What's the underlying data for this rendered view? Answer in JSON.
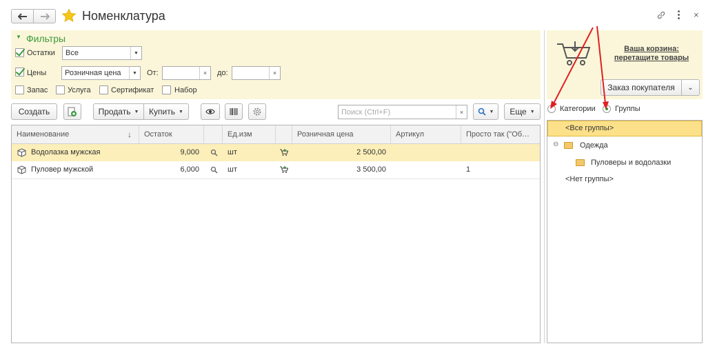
{
  "window": {
    "title": "Номенклатура",
    "back_icon": "arrow-left-icon",
    "forward_icon": "arrow-right-icon",
    "favorite_icon": "star-icon",
    "link_icon": "link-icon",
    "more_icon": "more-vertical-icon",
    "close_icon": "close-icon"
  },
  "filters": {
    "header": "Фильтры",
    "stock": {
      "label": "Остатки",
      "checked": true,
      "value": "Все"
    },
    "prices": {
      "label": "Цены",
      "checked": true,
      "value": "Розничная цена",
      "from_label": "От:",
      "to_label": "до:",
      "from_value": "",
      "to_value": ""
    },
    "kinds": [
      {
        "label": "Запас",
        "checked": false
      },
      {
        "label": "Услуга",
        "checked": false
      },
      {
        "label": "Сертификат",
        "checked": false
      },
      {
        "label": "Набор",
        "checked": false
      }
    ]
  },
  "toolbar": {
    "create": "Создать",
    "sell": "Продать",
    "buy": "Купить",
    "search_placeholder": "Поиск (Ctrl+F)",
    "more": "Еще"
  },
  "table": {
    "columns": [
      "Наименование",
      "Остаток",
      "",
      "Ед.изм",
      "",
      "Розничная цена",
      "Артикул",
      "Просто так (\"Об…"
    ],
    "sort_indicator": "↓",
    "rows": [
      {
        "name": "Водолазка мужская",
        "stock": "9,000",
        "unit": "шт",
        "price": "2 500,00",
        "article": "",
        "extra": ""
      },
      {
        "name": "Пуловер мужской",
        "stock": "6,000",
        "unit": "шт",
        "price": "3 500,00",
        "article": "",
        "extra": "1"
      }
    ]
  },
  "cart": {
    "line1": "Ваша корзина:",
    "line2": "перетащите товары",
    "order_button": "Заказ покупателя"
  },
  "grouping": {
    "categories": "Категории",
    "groups": "Группы",
    "selected": "groups"
  },
  "tree": {
    "all": "<Все группы>",
    "clothes": "Одежда",
    "sweaters": "Пуловеры и водолазки",
    "none": "<Нет группы>"
  },
  "colors": {
    "accent_green": "#3c9a3c",
    "filter_bg": "#fbf6d9",
    "selection": "#fcefb9",
    "tree_selection": "#fde18a",
    "annotation_red": "#e02020"
  }
}
